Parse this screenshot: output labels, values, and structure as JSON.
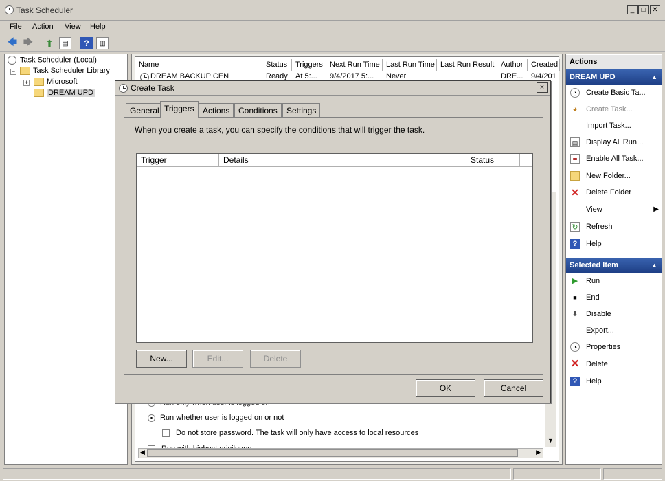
{
  "window": {
    "title": "Task Scheduler"
  },
  "menubar": [
    "File",
    "Action",
    "View",
    "Help"
  ],
  "tree": {
    "root": "Task Scheduler (Local)",
    "library": "Task Scheduler Library",
    "microsoft": "Microsoft",
    "selected": "DREAM UPD"
  },
  "task_list": {
    "columns": [
      "Name",
      "Status",
      "Triggers",
      "Next Run Time",
      "Last Run Time",
      "Last Run Result",
      "Author",
      "Created"
    ],
    "rows": [
      [
        "DREAM BACKUP CEN",
        "Ready",
        "At 5:...",
        "9/4/2017 5:...",
        "Never",
        "",
        "DRE...",
        "9/4/201"
      ]
    ]
  },
  "background_general": {
    "run_logged_on": "Run only when user is logged on",
    "run_whether": "Run whether user is logged on or not",
    "no_store_password": "Do not store password.  The task will only have access to local resources",
    "run_highest": "Run with highest privileges"
  },
  "actions_pane": {
    "header": "Actions",
    "section1": {
      "title": "DREAM UPD",
      "items": [
        "Create Basic Ta...",
        "Create Task...",
        "Import Task...",
        "Display All Run...",
        "Enable All Task...",
        "New Folder...",
        "Delete Folder",
        "View",
        "Refresh",
        "Help"
      ]
    },
    "section2": {
      "title": "Selected Item",
      "items": [
        "Run",
        "End",
        "Disable",
        "Export...",
        "Properties",
        "Delete",
        "Help"
      ]
    }
  },
  "dialog": {
    "title": "Create Task",
    "close": "×",
    "tabs": [
      "General",
      "Triggers",
      "Actions",
      "Conditions",
      "Settings"
    ],
    "active_tab": "Triggers",
    "description": "When you create a task, you can specify the conditions that will trigger the task.",
    "columns": [
      "Trigger",
      "Details",
      "Status"
    ],
    "buttons": {
      "new": "New...",
      "edit": "Edit...",
      "delete": "Delete",
      "ok": "OK",
      "cancel": "Cancel"
    }
  }
}
